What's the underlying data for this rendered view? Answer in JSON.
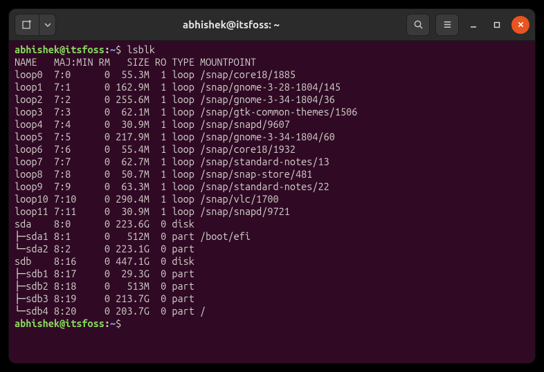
{
  "window": {
    "title": "abhishek@itsfoss: ~"
  },
  "prompt": {
    "userhost": "abhishek@itsfoss",
    "path": "~",
    "dollar": "$"
  },
  "command": "lsblk",
  "header": {
    "name": "NAME",
    "majmin": "MAJ:MIN",
    "rm": "RM",
    "size": "SIZE",
    "ro": "RO",
    "type": "TYPE",
    "mount": "MOUNTPOINT"
  },
  "rows": [
    {
      "tree": "",
      "name": "loop0",
      "majmin": "7:0",
      "rm": "0",
      "size": "55.3M",
      "ro": "1",
      "type": "loop",
      "mount": "/snap/core18/1885"
    },
    {
      "tree": "",
      "name": "loop1",
      "majmin": "7:1",
      "rm": "0",
      "size": "162.9M",
      "ro": "1",
      "type": "loop",
      "mount": "/snap/gnome-3-28-1804/145"
    },
    {
      "tree": "",
      "name": "loop2",
      "majmin": "7:2",
      "rm": "0",
      "size": "255.6M",
      "ro": "1",
      "type": "loop",
      "mount": "/snap/gnome-3-34-1804/36"
    },
    {
      "tree": "",
      "name": "loop3",
      "majmin": "7:3",
      "rm": "0",
      "size": "62.1M",
      "ro": "1",
      "type": "loop",
      "mount": "/snap/gtk-common-themes/1506"
    },
    {
      "tree": "",
      "name": "loop4",
      "majmin": "7:4",
      "rm": "0",
      "size": "30.9M",
      "ro": "1",
      "type": "loop",
      "mount": "/snap/snapd/9607"
    },
    {
      "tree": "",
      "name": "loop5",
      "majmin": "7:5",
      "rm": "0",
      "size": "217.9M",
      "ro": "1",
      "type": "loop",
      "mount": "/snap/gnome-3-34-1804/60"
    },
    {
      "tree": "",
      "name": "loop6",
      "majmin": "7:6",
      "rm": "0",
      "size": "55.4M",
      "ro": "1",
      "type": "loop",
      "mount": "/snap/core18/1932"
    },
    {
      "tree": "",
      "name": "loop7",
      "majmin": "7:7",
      "rm": "0",
      "size": "62.7M",
      "ro": "1",
      "type": "loop",
      "mount": "/snap/standard-notes/13"
    },
    {
      "tree": "",
      "name": "loop8",
      "majmin": "7:8",
      "rm": "0",
      "size": "50.7M",
      "ro": "1",
      "type": "loop",
      "mount": "/snap/snap-store/481"
    },
    {
      "tree": "",
      "name": "loop9",
      "majmin": "7:9",
      "rm": "0",
      "size": "63.3M",
      "ro": "1",
      "type": "loop",
      "mount": "/snap/standard-notes/22"
    },
    {
      "tree": "",
      "name": "loop10",
      "majmin": "7:10",
      "rm": "0",
      "size": "290.4M",
      "ro": "1",
      "type": "loop",
      "mount": "/snap/vlc/1700"
    },
    {
      "tree": "",
      "name": "loop11",
      "majmin": "7:11",
      "rm": "0",
      "size": "30.9M",
      "ro": "1",
      "type": "loop",
      "mount": "/snap/snapd/9721"
    },
    {
      "tree": "",
      "name": "sda",
      "majmin": "8:0",
      "rm": "0",
      "size": "223.6G",
      "ro": "0",
      "type": "disk",
      "mount": ""
    },
    {
      "tree": "├─",
      "name": "sda1",
      "majmin": "8:1",
      "rm": "0",
      "size": "512M",
      "ro": "0",
      "type": "part",
      "mount": "/boot/efi"
    },
    {
      "tree": "└─",
      "name": "sda2",
      "majmin": "8:2",
      "rm": "0",
      "size": "223.1G",
      "ro": "0",
      "type": "part",
      "mount": ""
    },
    {
      "tree": "",
      "name": "sdb",
      "majmin": "8:16",
      "rm": "0",
      "size": "447.1G",
      "ro": "0",
      "type": "disk",
      "mount": ""
    },
    {
      "tree": "├─",
      "name": "sdb1",
      "majmin": "8:17",
      "rm": "0",
      "size": "29.3G",
      "ro": "0",
      "type": "part",
      "mount": ""
    },
    {
      "tree": "├─",
      "name": "sdb2",
      "majmin": "8:18",
      "rm": "0",
      "size": "513M",
      "ro": "0",
      "type": "part",
      "mount": ""
    },
    {
      "tree": "├─",
      "name": "sdb3",
      "majmin": "8:19",
      "rm": "0",
      "size": "213.7G",
      "ro": "0",
      "type": "part",
      "mount": ""
    },
    {
      "tree": "└─",
      "name": "sdb4",
      "majmin": "8:20",
      "rm": "0",
      "size": "203.7G",
      "ro": "0",
      "type": "part",
      "mount": "/"
    }
  ]
}
